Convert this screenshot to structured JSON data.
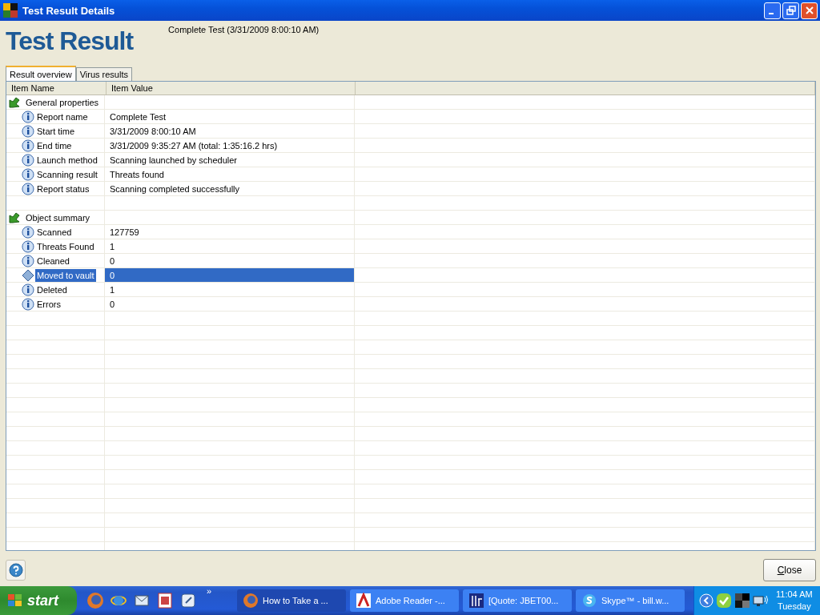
{
  "window": {
    "title": "Test Result Details"
  },
  "header": {
    "title": "Test Result",
    "subtitle": "Complete Test (3/31/2009 8:00:10 AM)"
  },
  "tabs": [
    {
      "label": "Result overview",
      "selected": true
    },
    {
      "label": "Virus results",
      "selected": false
    }
  ],
  "table": {
    "columns": [
      "Item Name",
      "Item Value"
    ],
    "rows": [
      {
        "kind": "group",
        "name": "General properties",
        "selected": false
      },
      {
        "kind": "item",
        "name": "Report name",
        "value": "Complete Test",
        "selected": false
      },
      {
        "kind": "item",
        "name": "Start time",
        "value": "3/31/2009 8:00:10 AM",
        "selected": false
      },
      {
        "kind": "item",
        "name": "End time",
        "value": "3/31/2009 9:35:27 AM  (total: 1:35:16.2 hrs)",
        "selected": false
      },
      {
        "kind": "item",
        "name": "Launch method",
        "value": "Scanning launched by scheduler",
        "selected": false
      },
      {
        "kind": "item",
        "name": "Scanning result",
        "value": "Threats found",
        "selected": false
      },
      {
        "kind": "item",
        "name": "Report status",
        "value": "Scanning completed successfully",
        "selected": false
      },
      {
        "kind": "spacer",
        "selected": false
      },
      {
        "kind": "group",
        "name": "Object summary",
        "selected": false
      },
      {
        "kind": "item",
        "name": "Scanned",
        "value": "127759",
        "selected": false
      },
      {
        "kind": "item",
        "name": "Threats Found",
        "value": "1",
        "selected": false
      },
      {
        "kind": "item",
        "name": "Cleaned",
        "value": "0",
        "selected": false
      },
      {
        "kind": "item",
        "name": "Moved to vault",
        "value": "0",
        "selected": true
      },
      {
        "kind": "item",
        "name": "Deleted",
        "value": "1",
        "selected": false
      },
      {
        "kind": "item",
        "name": "Errors",
        "value": "0",
        "selected": false
      }
    ]
  },
  "buttons": {
    "close": "Close"
  },
  "taskbar": {
    "start": "start",
    "more": "»",
    "tasks": [
      {
        "label": "How to Take a ...",
        "kind": "firefox",
        "selected": true
      },
      {
        "label": "Adobe Reader -...",
        "kind": "reader",
        "selected": false
      },
      {
        "label": "[Quote: JBET00...",
        "kind": "quote",
        "selected": false
      },
      {
        "label": "Skype™ - bill.w...",
        "kind": "skype",
        "selected": false
      }
    ],
    "clock": {
      "time": "11:04 AM",
      "day": "Tuesday"
    }
  }
}
